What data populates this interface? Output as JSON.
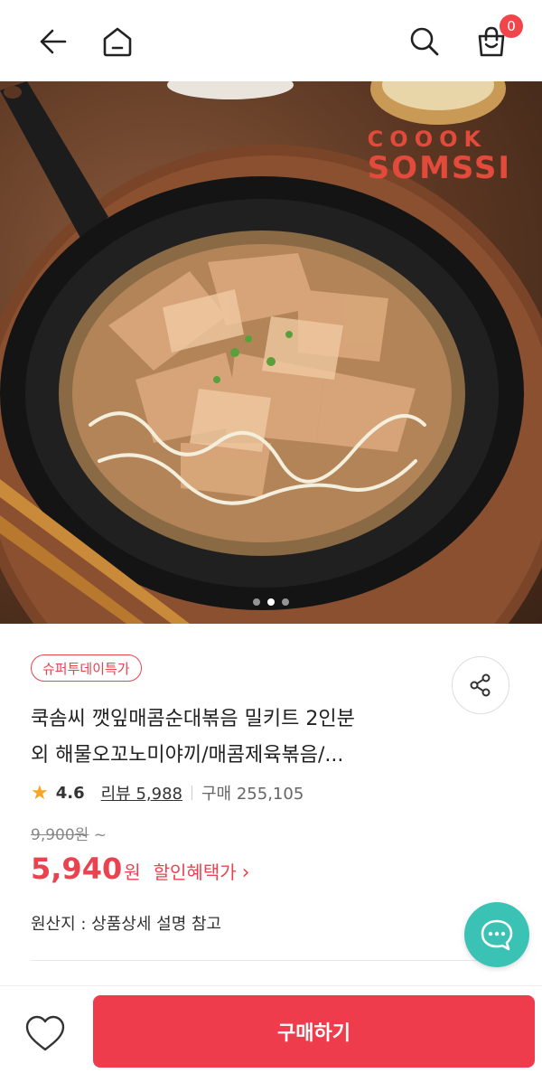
{
  "header": {
    "back_icon": "arrow-left-icon",
    "home_icon": "home-icon",
    "search_icon": "search-icon",
    "cart_icon": "shopping-bag-icon",
    "cart_count": "0"
  },
  "hero": {
    "brand_line1": "COOOK",
    "brand_line2": "SOMSSI",
    "slide_count": 3,
    "active_slide": 2
  },
  "product": {
    "deal_badge": "슈퍼투데이특가",
    "title_line1": "쿡솜씨 깻잎매콤순대볶음 밀키트 2인분",
    "title_line2": "외 해물오꼬노미야끼/매콤제육볶음/...",
    "rating": "4.6",
    "review_label": "리뷰 5,988",
    "sales_label": "구매 255,105",
    "original_price": "9,900원",
    "original_suffix": "~",
    "price": "5,940",
    "price_unit": "원",
    "benefit_label": "할인혜택가",
    "origin": "원산지 : 상품상세 설명 참고"
  },
  "actions": {
    "share_icon": "share-icon",
    "chat_icon": "chat-bubble-icon",
    "wishlist_icon": "heart-icon",
    "buy_label": "구매하기"
  },
  "colors": {
    "accent": "#ee3c4c",
    "badge_red": "#f0454a",
    "chat_teal": "#3ac3b4",
    "star": "#f5a623",
    "brand_red": "#e24a3b"
  }
}
